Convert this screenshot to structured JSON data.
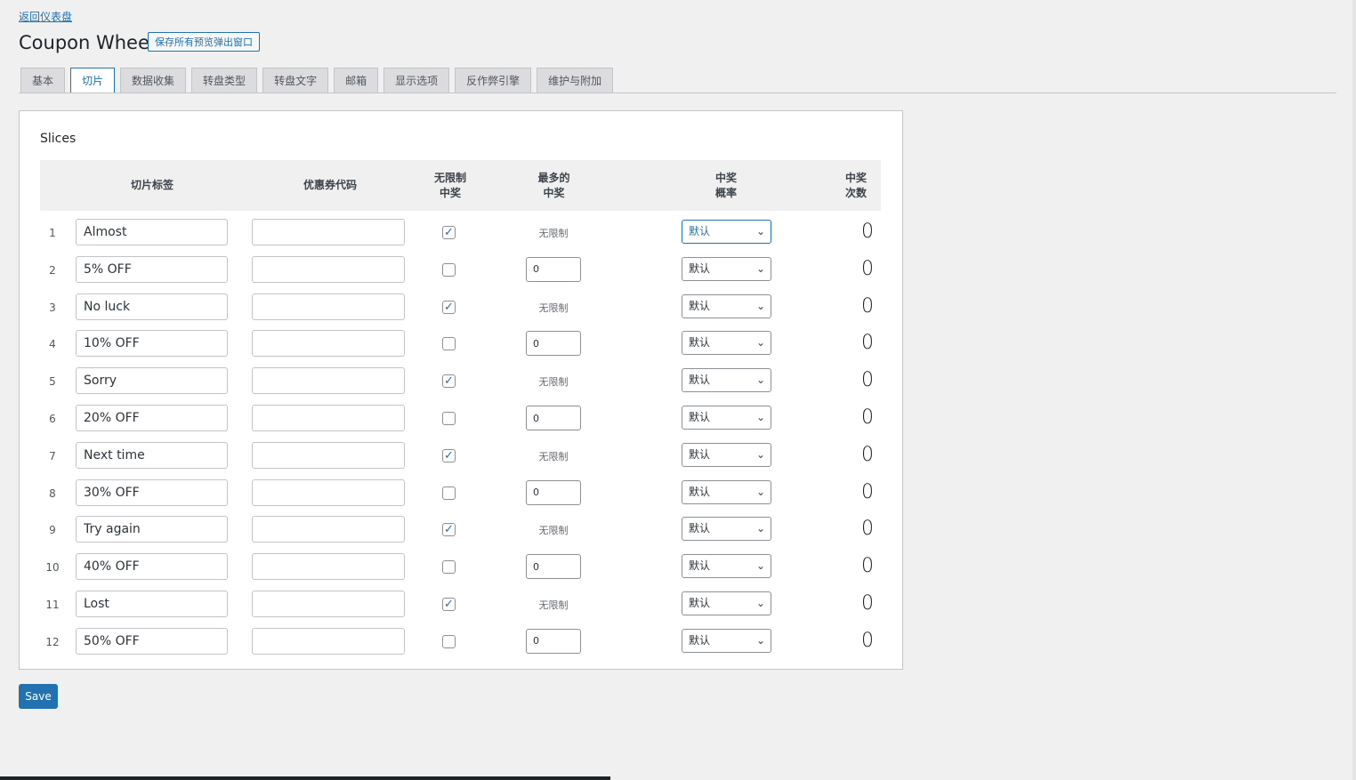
{
  "back_link": "返回仪表盘",
  "title": "Coupon Wheel",
  "save_all_button": "保存所有预览弹出窗口",
  "tabs": [
    {
      "label": "基本"
    },
    {
      "label": "切片",
      "active": true
    },
    {
      "label": "数据收集"
    },
    {
      "label": "转盘类型"
    },
    {
      "label": "转盘文字"
    },
    {
      "label": "邮箱"
    },
    {
      "label": "显示选项"
    },
    {
      "label": "反作弊引擎"
    },
    {
      "label": "维护与附加"
    }
  ],
  "panel": {
    "title": "Slices",
    "headers": {
      "label": "切片标签",
      "code": "优惠券代码",
      "unlimited": "无限制\n中奖",
      "max": "最多的\n中奖",
      "probability": "中奖\n概率",
      "count": "中奖\n次数"
    },
    "unlimited_text": "无限制",
    "rows": [
      {
        "num": "1",
        "label": "Almost",
        "code": "",
        "unlimited": true,
        "max": "",
        "probability": "默认",
        "count": "0"
      },
      {
        "num": "2",
        "label": "5% OFF",
        "code": "",
        "unlimited": false,
        "max": "0",
        "probability": "默认",
        "count": "0"
      },
      {
        "num": "3",
        "label": "No luck",
        "code": "",
        "unlimited": true,
        "max": "",
        "probability": "默认",
        "count": "0"
      },
      {
        "num": "4",
        "label": "10% OFF",
        "code": "",
        "unlimited": false,
        "max": "0",
        "probability": "默认",
        "count": "0"
      },
      {
        "num": "5",
        "label": "Sorry",
        "code": "",
        "unlimited": true,
        "max": "",
        "probability": "默认",
        "count": "0"
      },
      {
        "num": "6",
        "label": "20% OFF",
        "code": "",
        "unlimited": false,
        "max": "0",
        "probability": "默认",
        "count": "0"
      },
      {
        "num": "7",
        "label": "Next time",
        "code": "",
        "unlimited": true,
        "max": "",
        "probability": "默认",
        "count": "0"
      },
      {
        "num": "8",
        "label": "30% OFF",
        "code": "",
        "unlimited": false,
        "max": "0",
        "probability": "默认",
        "count": "0"
      },
      {
        "num": "9",
        "label": "Try again",
        "code": "",
        "unlimited": true,
        "max": "",
        "probability": "默认",
        "count": "0"
      },
      {
        "num": "10",
        "label": "40% OFF",
        "code": "",
        "unlimited": false,
        "max": "0",
        "probability": "默认",
        "count": "0"
      },
      {
        "num": "11",
        "label": "Lost",
        "code": "",
        "unlimited": true,
        "max": "",
        "probability": "默认",
        "count": "0"
      },
      {
        "num": "12",
        "label": "50% OFF",
        "code": "",
        "unlimited": false,
        "max": "0",
        "probability": "默认",
        "count": "0"
      }
    ]
  },
  "save_button": "Save",
  "colors": {
    "accent": "#2271b1",
    "background": "#f0f0f1",
    "panel": "#ffffff",
    "border": "#c3c4c7"
  },
  "icons": {
    "select_arrow": "chevron-down-icon",
    "checkbox_mark": "check-icon"
  }
}
